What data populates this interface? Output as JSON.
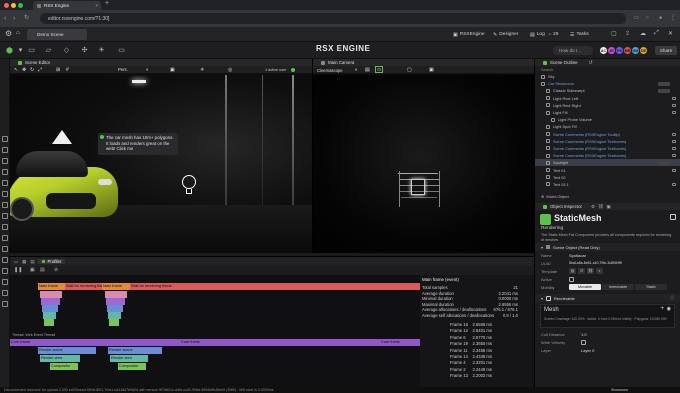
{
  "browser": {
    "tab_title": "RSX Engine",
    "url": "editor.rsxengine.com/?1:30]"
  },
  "app_menu": {
    "scene_tab": "Demo Scene",
    "items": [
      "RSXEngine",
      "Designer",
      "Log",
      "29",
      "Tasks"
    ]
  },
  "toolbar": {
    "logo": "RSX ENGINE",
    "search_placeholder": "How do I...",
    "share_label": "Share",
    "avatars": [
      {
        "initials": "AC",
        "color": "#f2f2f2"
      },
      {
        "initials": "JR",
        "color": "#c94fd6"
      },
      {
        "initials": "PS",
        "color": "#6a5cf0"
      },
      {
        "initials": "MR",
        "color": "#d9534f"
      },
      {
        "initials": "GM",
        "color": "#4aa3df"
      },
      {
        "initials": "DE",
        "color": "#e0a030"
      }
    ]
  },
  "scene_editor": {
    "title": "Scene Editor",
    "view_mode": "Pers.",
    "active_users": "1 active user",
    "tooltip": "The car mesh has 10m+ polygons. It loads and renders great on the web! Click me"
  },
  "main_camera": {
    "title": "Main Camera",
    "view_mode": "Cinemascope"
  },
  "profiler": {
    "title": "Profiler",
    "flame_frames": [
      {
        "label": "Main frame",
        "color": "#e08a3a"
      },
      {
        "label": "Wait for rendering frame",
        "color": "#d95a5a"
      },
      {
        "label": "Main frame",
        "color": "#e08a3a"
      },
      {
        "label": "Wait for rendering frame",
        "color": "#d95a5a"
      }
    ],
    "thread_label": "Thread: Web Event Thread",
    "render_frames": [
      {
        "label": "Core frame",
        "color": "#8f57c9"
      },
      {
        "label": "Render scene",
        "color": "#6a8ed6"
      },
      {
        "label": "Render view",
        "color": "#5fb8a8"
      },
      {
        "label": "Compositor",
        "color": "#7bc45a"
      },
      {
        "label": "Core frame",
        "color": "#8f57c9"
      },
      {
        "label": "Render scene",
        "color": "#6a8ed6"
      },
      {
        "label": "Render view",
        "color": "#5fb8a8"
      },
      {
        "label": "Compositor",
        "color": "#7bc45a"
      },
      {
        "label": "Core frame",
        "color": "#8f57c9"
      }
    ],
    "stats_title": "Main frame (event)",
    "stats": [
      {
        "label": "Total samples",
        "value": "21"
      },
      {
        "label": "Average duration",
        "value": "2.2041 ms"
      },
      {
        "label": "Minimal duration",
        "value": "0.0000 ms"
      },
      {
        "label": "Maximal duration",
        "value": "2.6556 ms"
      },
      {
        "label": "Average allocations / deallocations",
        "value": "676.1 / 675.1"
      },
      {
        "label": "Average self allocations / deallocations",
        "value": "0.8 / 1.0"
      }
    ],
    "frames": [
      {
        "label": "Frame 16",
        "value": "2.6556 ms"
      },
      {
        "label": "Frame 12",
        "value": "2.6401 ms"
      },
      {
        "label": "Frame 6",
        "value": "2.5770 ms"
      },
      {
        "label": "Frame 19",
        "value": "2.3550 ms"
      },
      {
        "label": "Frame 11",
        "value": "2.3456 ms"
      },
      {
        "label": "Frame 14",
        "value": "2.4348 ms"
      },
      {
        "label": "Frame 4",
        "value": "2.3201 ms"
      },
      {
        "label": "Frame 2",
        "value": "2.2449 ms"
      },
      {
        "label": "Frame 13",
        "value": "2.2003 ms"
      }
    ]
  },
  "scene_outline": {
    "title": "Scene Outline",
    "search_placeholder": "Search",
    "items": [
      {
        "label": "Sky",
        "indent": 0,
        "color": "#bfbfbf"
      },
      {
        "label": "Car Showroom",
        "indent": 0,
        "color": "#6fa4e0",
        "pill": true
      },
      {
        "label": "Classic Sideswept",
        "indent": 1,
        "color": "#bfbfbf",
        "pill": true
      },
      {
        "label": "Light Rect Left",
        "indent": 1,
        "color": "#bfbfbf",
        "lock": true
      },
      {
        "label": "Light Rect Right",
        "indent": 1,
        "color": "#bfbfbf",
        "lock": true
      },
      {
        "label": "Light Fill",
        "indent": 1,
        "color": "#bfbfbf",
        "lock": true
      },
      {
        "label": "Light Probe Volume",
        "indent": 2,
        "color": "#bfbfbf"
      },
      {
        "label": "Light Spot Fill",
        "indent": 1,
        "color": "#bfbfbf"
      },
      {
        "label": "Scene Comments (RSXEngine Tooltip)",
        "indent": 1,
        "color": "#6fa4e0",
        "lock": true
      },
      {
        "label": "Scene Comments (RSXEngine Textboxes)",
        "indent": 1,
        "color": "#6fa4e0",
        "lock": true
      },
      {
        "label": "Scene Comments (RSXEngine Textboxes)",
        "indent": 1,
        "color": "#6fa4e0",
        "lock": true
      },
      {
        "label": "Scene Comments (RSXEngine Textboxes)",
        "indent": 1,
        "color": "#6fa4e0",
        "lock": true
      },
      {
        "label": "Spotlight",
        "indent": 1,
        "color": "#bfbfbf",
        "selected": true,
        "pill": true
      },
      {
        "label": "Text 01",
        "indent": 1,
        "color": "#bfbfbf",
        "lock": true
      },
      {
        "label": "Text 02",
        "indent": 1,
        "color": "#bfbfbf"
      },
      {
        "label": "Text 03 1",
        "indent": 1,
        "color": "#bfbfbf",
        "lock": true
      }
    ],
    "footer": "World Object"
  },
  "inspector": {
    "title": "Object Inspector",
    "component_name": "StaticMesh",
    "component_type": "Rendering",
    "description": "The Static Mesh Fat Component provides all components required for rendering of meshes.",
    "section_title": "Scene Object (Read Only)",
    "name_label": "Name",
    "name_value": "Spotlacar",
    "uuid_label": "UUID",
    "uuid_value": "5ba1a5a-8e81-c40-7f9c-3c8f3f4fff",
    "template_label": "Template",
    "active_label": "Active",
    "mobility_label": "Mobility",
    "mobility_options": [
      "Movable",
      "Immovable",
      "Static"
    ],
    "renderable_title": "Renderable",
    "mesh_label": "Mesh",
    "mesh_info": "Screen Coverage: 100.00% · Active: 0 from 0.00m to Infinity · Polygons: 10,000,000",
    "cull_distance_label": "Cull Distance",
    "cull_distance_value": "1.0",
    "write_velocity_label": "Write Velocity",
    "layer_label": "Layer",
    "layer_value": "Layer 0"
  },
  "status_bar": {
    "text": "Disconnected resource for upload 2,000 ed2f3eeed-994d-8f01-7cfa1-cd418d7b9d2d with version 9f76821c-d4fd-cc83-9b8d-9894e6b45ee5 (3MB) · WB start in 3.0000ms",
    "right_label": "Showroom"
  },
  "colors": {
    "accent_green": "#5bc24a",
    "accent_blue": "#6fa4e0",
    "car_green": "#b7cf2a"
  }
}
